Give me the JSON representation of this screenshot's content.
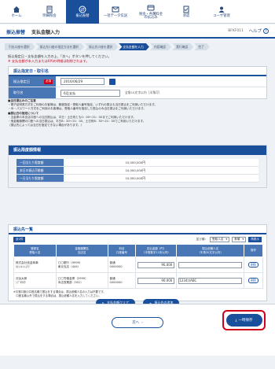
{
  "nav": [
    {
      "label": "ホーム",
      "icon": "home-icon"
    },
    {
      "label": "明細照会",
      "icon": "statement-icon"
    },
    {
      "label": "振込振替",
      "icon": "transfer-icon"
    },
    {
      "label": "一括データ伝送",
      "icon": "data-transmission-icon"
    },
    {
      "label": "税金・各種料金\nの払込み",
      "icon": "tax-payment-icon"
    },
    {
      "label": "承認",
      "icon": "approval-icon"
    },
    {
      "label": "ユーザ管理",
      "icon": "user-management-icon"
    }
  ],
  "title": {
    "category": "振込振替",
    "page": "支払金額入力",
    "screen_id": "BFKF011",
    "help": "ヘルプ"
  },
  "steps": [
    "引出口座を選択",
    "振込先口座の指定方法を選択",
    "振込先口座を選択",
    "支払金額を入力",
    "内容確認",
    "実行確認",
    "完了"
  ],
  "current_step": 3,
  "instructions": {
    "line1": "振込指定日・支払金額を入力の上、「次へ」ボタンを押してください。",
    "line2": "※ 支払金額が未入力または0円の明細は削除されます。"
  },
  "specify": {
    "heading": "振込指定日・取引名",
    "date_label": "振込指定日",
    "required": "必須",
    "date_value": "2016/06/29",
    "name_label": "取引名",
    "name_value": "6月支払",
    "name_hint": "全角10文字以内［半角可］"
  },
  "notes": [
    "■当日振込みのご注意",
    "・電子証明書方式をご利用のお客様は、都度指定・受取人番号指定、いずれの振込も当日振込をご利用いただけます。",
    "・ID・パスワード方式をご利用のお客様は、受取人番号を指定した振込のみ当日振込をご利用いただけます。",
    "■振込日の指定について",
    "・当金庫の本支店口座への当日振込は、平日・土日祝とも0：00〜21：00までご利用いただけます。",
    "・他金融機関の口座への当日振込は、平日8：30〜21：00、土日祝8：30〜21：00でご利用いただけます。",
    "（振込先によっては当日を指定できない場合があります。）"
  ],
  "limit": {
    "heading": "振込限度額情報",
    "rows": [
      {
        "label": "一回当たり限度額",
        "value": "10,000,000円"
      },
      {
        "label": "本日の振込可能額",
        "value": "10,000,000円"
      },
      {
        "label": "一日当たり限度額",
        "value": "10,000,000円"
      }
    ]
  },
  "list": {
    "heading": "振込先一覧",
    "count": "全2件",
    "sort_label": "並び順：",
    "sort_field": "受取人名",
    "sort_order": "昇順",
    "sort_button": "再表示",
    "headers": [
      "登録名\n受取人名",
      "金融機関名\n支店名",
      "科目\n口座番号",
      "支払金額（円）\n（半角数字11桁以内）",
      "振込依頼人名\n（半角30文字以内）",
      "操作"
    ],
    "rows": [
      {
        "reg": "株式会社信金商事",
        "payee": "ｶ)ｼﾝｷﾝｼｮｳｼﾞ",
        "bank": "〇〇銀行（9999）",
        "branch": "東京支店（444）",
        "type": "普通",
        "account": "0000000",
        "amount": "90,000",
        "requester": "",
        "op": "削除"
      },
      {
        "reg": "渋谷太郎",
        "payee": "ｼﾌﾞﾔﾀﾛｳ",
        "bank": "〇〇労働金庫（2999）",
        "branch": "本店営業部（301）",
        "type": "普通",
        "account": "0000000",
        "amount": "90,000",
        "requester": "1234ｶ)ABC",
        "op": "削除"
      }
    ],
    "note1": "※引落口座の口座名義で振込をする場合は、振込依頼人名の入力は不要です。",
    "note2": "　口座名義以外で振込をする場合は、振込依頼人名を入力してください。",
    "clear_button": "支払金額クリア",
    "add_button": "振込先の追加"
  },
  "buttons": {
    "next": "次へ",
    "save": "一時保存"
  },
  "colors": {
    "primary": "#1a4f9c",
    "header_cell": "#4976b4",
    "warning": "#d0021b"
  }
}
